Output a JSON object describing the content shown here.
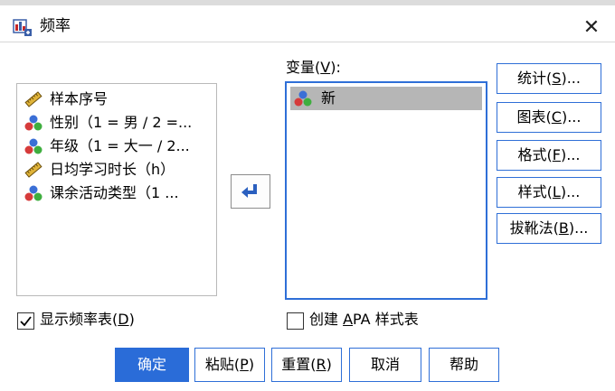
{
  "window": {
    "title": "频率"
  },
  "source_list": {
    "items": [
      {
        "label": "样本序号",
        "icon": "ruler-icon"
      },
      {
        "label": "性别（1 = 男 / 2 =...",
        "icon": "nominal-icon"
      },
      {
        "label": "年级（1 = 大一 / 2...",
        "icon": "nominal-icon"
      },
      {
        "label": "日均学习时长（h）",
        "icon": "ruler-icon"
      },
      {
        "label": "课余活动类型（1 ...",
        "icon": "nominal-icon"
      }
    ]
  },
  "variables": {
    "label_prefix": "变量(",
    "label_key": "V",
    "label_suffix": "):",
    "items": [
      {
        "label": "新",
        "icon": "nominal-icon"
      }
    ]
  },
  "side_buttons": [
    {
      "prefix": "统计(",
      "key": "S",
      "suffix": ")..."
    },
    {
      "prefix": "图表(",
      "key": "C",
      "suffix": ")..."
    },
    {
      "prefix": "格式(",
      "key": "F",
      "suffix": ")..."
    },
    {
      "prefix": "样式(",
      "key": "L",
      "suffix": ")..."
    },
    {
      "prefix": "拔靴法(",
      "key": "B",
      "suffix": ")..."
    }
  ],
  "options": {
    "show_freq_table": {
      "prefix": "显示频率表(",
      "key": "D",
      "suffix": ")",
      "checked": true
    },
    "create_apa": {
      "prefix": "创建 ",
      "key": "A",
      "suffix": "PA 样式表",
      "checked": false
    }
  },
  "bottom_buttons": {
    "ok": {
      "label": "确定"
    },
    "paste": {
      "prefix": "粘贴(",
      "key": "P",
      "suffix": ")"
    },
    "reset": {
      "prefix": "重置(",
      "key": "R",
      "suffix": ")"
    },
    "cancel": {
      "label": "取消"
    },
    "help": {
      "label": "帮助"
    }
  },
  "colors": {
    "accent": "#2f6fd7",
    "primary_button": "#2a6cd8",
    "selected_item": "#b6b6b6",
    "dialog_bg": "#ffffff"
  }
}
